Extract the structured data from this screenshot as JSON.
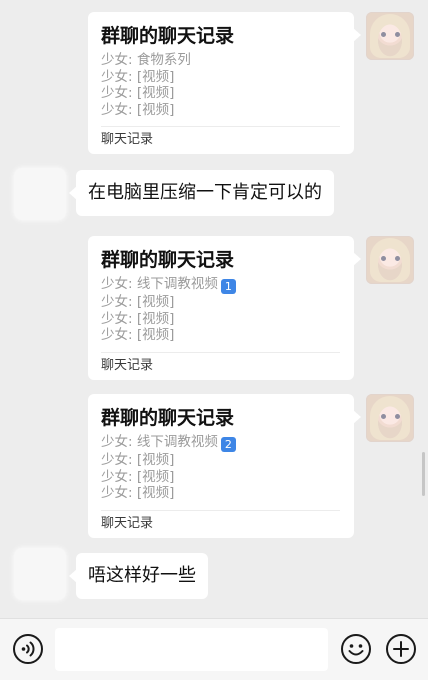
{
  "messages": [
    {
      "type": "chat_record",
      "title": "群聊的聊天记录",
      "lines": [
        "少女: 食物系列",
        "少女: [视频]",
        "少女: [视频]",
        "少女: [视频]"
      ],
      "footer": "聊天记录"
    },
    {
      "type": "text",
      "text": "在电脑里压缩一下肯定可以的"
    },
    {
      "type": "chat_record",
      "title": "群聊的聊天记录",
      "first_line": "少女: 线下调教视频",
      "first_line_badge": "1",
      "lines": [
        "少女: [视频]",
        "少女: [视频]",
        "少女: [视频]"
      ],
      "footer": "聊天记录"
    },
    {
      "type": "chat_record",
      "title": "群聊的聊天记录",
      "first_line": "少女: 线下调教视频",
      "first_line_badge": "2",
      "lines": [
        "少女: [视频]",
        "少女: [视频]",
        "少女: [视频]"
      ],
      "footer": "聊天记录"
    },
    {
      "type": "text",
      "text": "唔这样好一些"
    }
  ],
  "input_bar": {
    "voice_icon": "voice-icon",
    "emoji_icon": "emoji-icon",
    "add_icon": "plus-circle-icon",
    "input_value": ""
  },
  "colors": {
    "background": "#ededed",
    "bubble": "#ffffff",
    "badge": "#3e86e6"
  }
}
